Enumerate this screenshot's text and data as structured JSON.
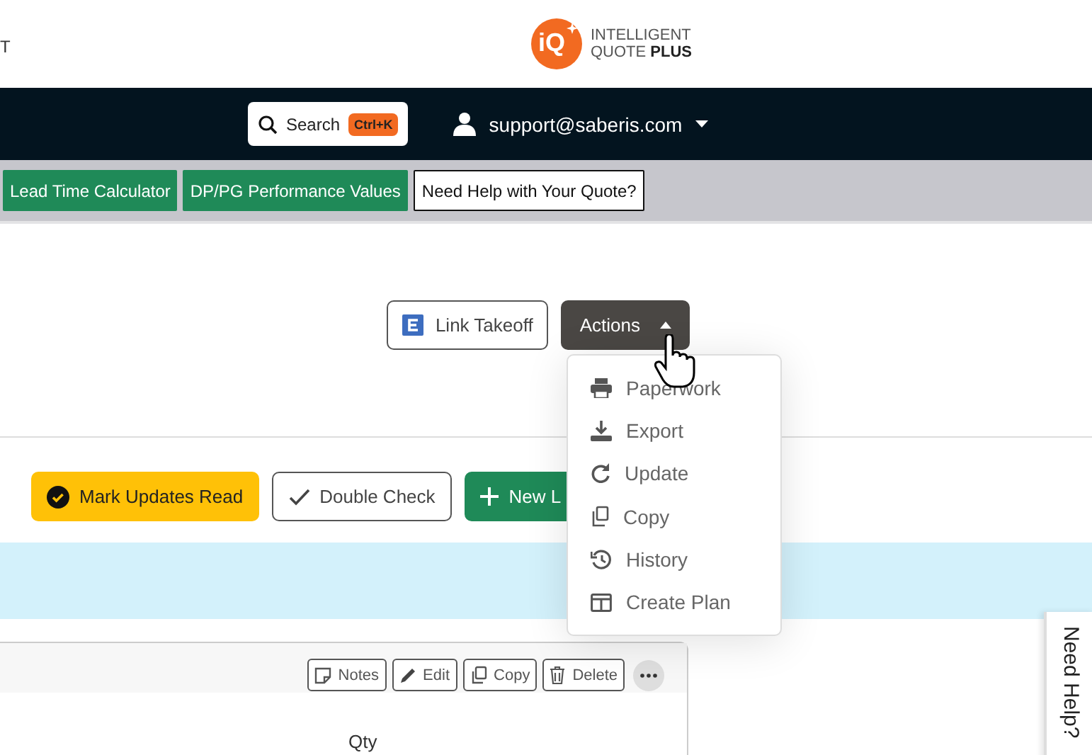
{
  "header": {
    "left_text": "T",
    "logo": {
      "badge": "iQ",
      "line1": "INTELLIGENT",
      "line2": "QUOTE **PLUS**"
    }
  },
  "navbar": {
    "search": {
      "label": "Search",
      "shortcut": "Ctrl+K"
    },
    "user": "support@saberis.com"
  },
  "tools": [
    {
      "label": "Lead Time Calculator",
      "kind": "filled"
    },
    {
      "label": "DP/PG Performance Values",
      "kind": "filled"
    },
    {
      "label": "Need Help with Your Quote?",
      "kind": "outline"
    }
  ],
  "link_takeoff": "Link Takeoff",
  "actions": {
    "label": "Actions",
    "expanded": true,
    "items": [
      "Paperwork",
      "Export",
      "Update",
      "Copy",
      "History",
      "Create Plan"
    ]
  },
  "row_buttons": [
    {
      "label": "Mark Updates Read",
      "kind": "warning"
    },
    {
      "label": "Double Check",
      "kind": "outline"
    },
    {
      "label": "New L",
      "kind": "success"
    }
  ],
  "card": {
    "buttons": [
      "Notes",
      "Edit",
      "Copy",
      "Delete"
    ],
    "column": "Qty"
  },
  "side_tab": "Need Help?"
}
